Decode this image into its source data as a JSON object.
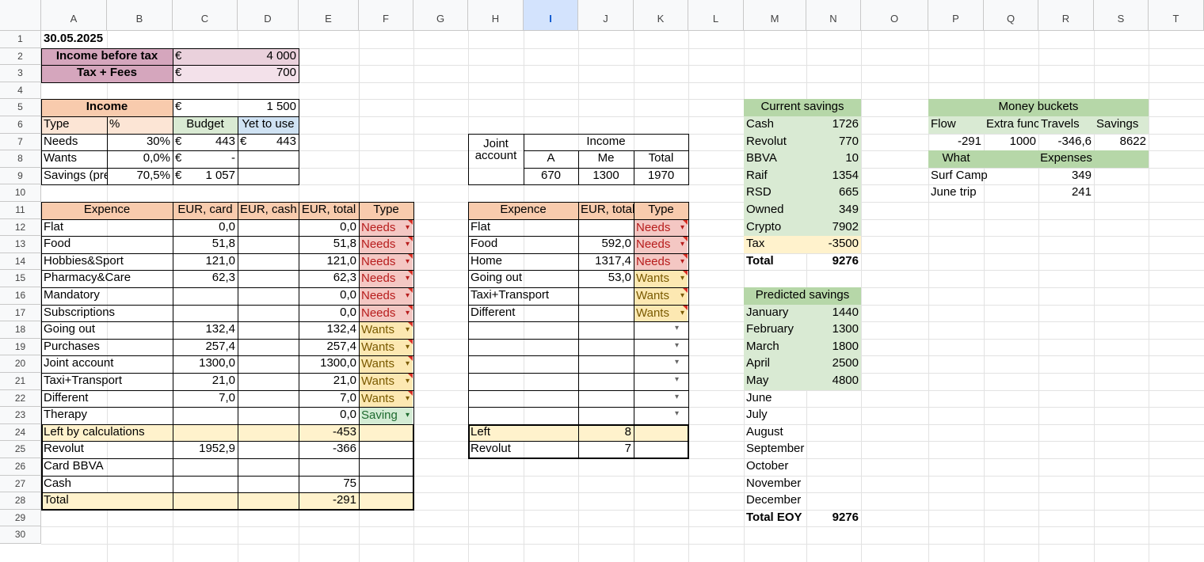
{
  "columns": [
    "A",
    "B",
    "C",
    "D",
    "E",
    "F",
    "G",
    "H",
    "I",
    "J",
    "K",
    "L",
    "M",
    "N",
    "O",
    "P",
    "Q",
    "R",
    "S",
    "T"
  ],
  "selected_column": "I",
  "rows": [
    "1",
    "2",
    "3",
    "4",
    "5",
    "6",
    "7",
    "8",
    "9",
    "10",
    "11",
    "12",
    "13",
    "14",
    "15",
    "16",
    "17",
    "18",
    "19",
    "20",
    "21",
    "22",
    "23",
    "24",
    "25",
    "26",
    "27",
    "28",
    "29",
    "30"
  ],
  "colors": {
    "pink": "#ead1dc",
    "pink_dark": "#d5a6bd",
    "orange": "#f8cbad",
    "orange_light": "#fce5d5",
    "green": "#b6d7a8",
    "green_light": "#d9ead3",
    "blue_light": "#cfe2f3",
    "yellow": "#fff2cc",
    "needs": "#f4c7c3",
    "wants": "#fce8b2",
    "saving": "#d4ecd5"
  },
  "header_block": {
    "date": "30.05.2025",
    "income_before_tax_label": "Income before tax",
    "income_before_tax_cur": "€",
    "income_before_tax_value": "4 000",
    "tax_label": "Tax + Fees",
    "tax_cur": "€",
    "tax_value": "700"
  },
  "budget": {
    "income_label": "Income",
    "income_cur": "€",
    "income_value": "1 500",
    "col_type": "Type",
    "col_pct": "%",
    "col_budget": "Budget",
    "col_yet": "Yet to use",
    "rows": [
      {
        "type": "Needs",
        "pct": "30%",
        "cur": "€",
        "budget": "443",
        "cur2": "€",
        "yet": "443"
      },
      {
        "type": "Wants",
        "pct": "0,0%",
        "cur": "€",
        "budget": "-",
        "cur2": "",
        "yet": ""
      },
      {
        "type": "Savings (pre",
        "pct": "70,5%",
        "cur": "€",
        "budget": "1 057",
        "cur2": "",
        "yet": ""
      }
    ]
  },
  "expenses": {
    "headers": [
      "Expence",
      "EUR, card",
      "EUR, cash",
      "EUR, total",
      "Type"
    ],
    "rows": [
      {
        "name": "Flat",
        "card": "0,0",
        "cash": "",
        "total": "0,0",
        "type": "Needs"
      },
      {
        "name": "Food",
        "card": "51,8",
        "cash": "",
        "total": "51,8",
        "type": "Needs"
      },
      {
        "name": "Hobbies&Sport",
        "card": "121,0",
        "cash": "",
        "total": "121,0",
        "type": "Needs"
      },
      {
        "name": "Pharmacy&Care",
        "card": "62,3",
        "cash": "",
        "total": "62,3",
        "type": "Needs"
      },
      {
        "name": "Mandatory",
        "card": "",
        "cash": "",
        "total": "0,0",
        "type": "Needs"
      },
      {
        "name": "Subscriptions",
        "card": "",
        "cash": "",
        "total": "0,0",
        "type": "Needs"
      },
      {
        "name": "Going out",
        "card": "132,4",
        "cash": "",
        "total": "132,4",
        "type": "Wants"
      },
      {
        "name": "Purchases",
        "card": "257,4",
        "cash": "",
        "total": "257,4",
        "type": "Wants"
      },
      {
        "name": "Joint account",
        "card": "1300,0",
        "cash": "",
        "total": "1300,0",
        "type": "Wants"
      },
      {
        "name": "Taxi+Transport",
        "card": "21,0",
        "cash": "",
        "total": "21,0",
        "type": "Wants"
      },
      {
        "name": "Different",
        "card": "7,0",
        "cash": "",
        "total": "7,0",
        "type": "Wants"
      },
      {
        "name": "Therapy",
        "card": "",
        "cash": "",
        "total": "0,0",
        "type": "Saving"
      }
    ],
    "summary": [
      {
        "name": "Left by calculations",
        "card": "",
        "total": "-453"
      },
      {
        "name": "Revolut",
        "card": "1952,9",
        "total": "-366"
      },
      {
        "name": "Card BBVA",
        "card": "",
        "total": ""
      },
      {
        "name": "Cash",
        "card": "",
        "total": "75"
      },
      {
        "name": "Total",
        "card": "",
        "total": "-291"
      }
    ]
  },
  "joint": {
    "label_line1": "Joint",
    "label_line2": "account",
    "income_label": "Income",
    "cols": [
      "A",
      "Me",
      "Total"
    ],
    "values": [
      "670",
      "1300",
      "1970"
    ],
    "headers": [
      "Expence",
      "EUR, total",
      "Type"
    ],
    "rows": [
      {
        "name": "Flat",
        "total": "",
        "type": "Needs"
      },
      {
        "name": "Food",
        "total": "592,0",
        "type": "Needs"
      },
      {
        "name": "Home",
        "total": "1317,4",
        "type": "Needs"
      },
      {
        "name": "Going out",
        "total": "53,0",
        "type": "Wants"
      },
      {
        "name": "Taxi+Transport",
        "total": "",
        "type": "Wants"
      },
      {
        "name": "Different",
        "total": "",
        "type": "Wants"
      }
    ],
    "left_label": "Left",
    "left_value": "8",
    "revolut_label": "Revolut",
    "revolut_value": "7"
  },
  "current_savings": {
    "title": "Current savings",
    "rows": [
      {
        "name": "Cash",
        "value": "1726"
      },
      {
        "name": "Revolut",
        "value": "770"
      },
      {
        "name": "BBVA",
        "value": "10"
      },
      {
        "name": "Raif",
        "value": "1354"
      },
      {
        "name": "RSD",
        "value": "665"
      },
      {
        "name": "Owned",
        "value": "349"
      },
      {
        "name": "Crypto",
        "value": "7902"
      },
      {
        "name": "Tax",
        "value": "-3500"
      }
    ],
    "total_label": "Total",
    "total_value": "9276"
  },
  "predicted_savings": {
    "title": "Predicted savings",
    "rows": [
      {
        "name": "January",
        "value": "1440"
      },
      {
        "name": "February",
        "value": "1300"
      },
      {
        "name": "March",
        "value": "1800"
      },
      {
        "name": "April",
        "value": "2500"
      },
      {
        "name": "May",
        "value": "4800"
      },
      {
        "name": "June",
        "value": ""
      },
      {
        "name": "July",
        "value": ""
      },
      {
        "name": "August",
        "value": ""
      },
      {
        "name": "September",
        "value": ""
      },
      {
        "name": "October",
        "value": ""
      },
      {
        "name": "November",
        "value": ""
      },
      {
        "name": "December",
        "value": ""
      }
    ],
    "total_label": "Total EOY",
    "total_value": "9276"
  },
  "money_buckets": {
    "title": "Money buckets",
    "headers": [
      "Flow",
      "Extra func",
      "Travels",
      "Savings"
    ],
    "values": [
      "-291",
      "1000",
      "-346,6",
      "8622"
    ],
    "what_label": "What",
    "expenses_label": "Expenses",
    "items": [
      {
        "name": "Surf Camp",
        "value": "349"
      },
      {
        "name": "June trip",
        "value": "241"
      }
    ]
  }
}
